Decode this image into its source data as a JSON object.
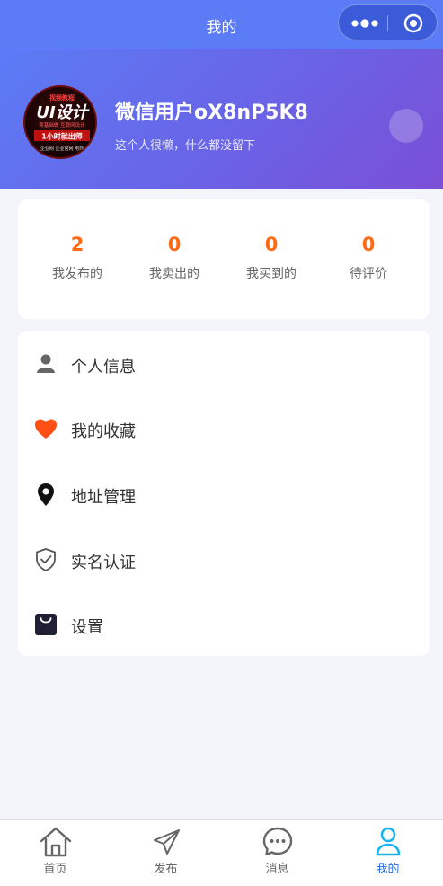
{
  "navbar": {
    "title": "我的"
  },
  "profile": {
    "username": "微信用户oX8nP5K8",
    "bio": "这个人很懒，什么都没留下",
    "avatar_text": {
      "top": "视频教程",
      "main": "UI设计",
      "mid": "零基础做 互联网设计",
      "badge": "1小时就出师",
      "bottom": "企业网 企业官网 电商"
    }
  },
  "stats": [
    {
      "value": "2",
      "label": "我发布的"
    },
    {
      "value": "0",
      "label": "我卖出的"
    },
    {
      "value": "0",
      "label": "我买到的"
    },
    {
      "value": "0",
      "label": "待评价"
    }
  ],
  "menu": [
    {
      "label": "个人信息",
      "icon": "person-icon"
    },
    {
      "label": "我的收藏",
      "icon": "heart-icon"
    },
    {
      "label": "地址管理",
      "icon": "location-pin-icon"
    },
    {
      "label": "实名认证",
      "icon": "shield-check-icon"
    },
    {
      "label": "设置",
      "icon": "bag-icon"
    }
  ],
  "tabs": [
    {
      "label": "首页",
      "icon": "home-icon"
    },
    {
      "label": "发布",
      "icon": "paper-plane-icon"
    },
    {
      "label": "消息",
      "icon": "chat-bubble-icon"
    },
    {
      "label": "我的",
      "icon": "user-icon",
      "active": true
    }
  ],
  "colors": {
    "accent": "#ff6a13",
    "primary": "#5b7cf6",
    "tab_active": "#2a6fe0"
  }
}
